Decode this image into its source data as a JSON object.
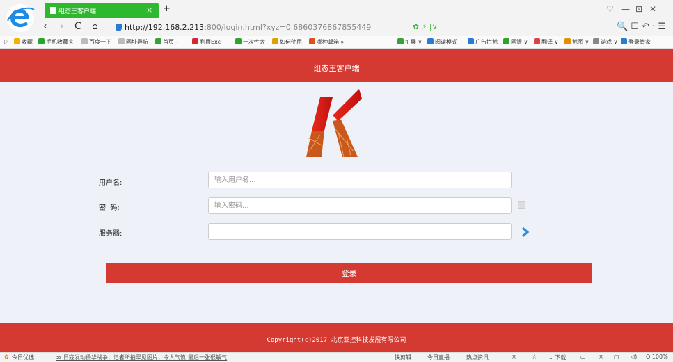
{
  "browser": {
    "tab_title": "组态王客户端",
    "tab_close": "×",
    "tab_new": "+",
    "url_host": "http://192.168.2.213",
    "url_rest": ":800/login.html?xyz=0.6860376867855449",
    "window_controls": [
      "♡",
      "—",
      "⊡",
      "✕"
    ],
    "nav": {
      "back": "‹",
      "forward": "›",
      "reload": "C",
      "home": "⌂"
    },
    "addr_right": "🔍  ☐  ↶ ·  ☰",
    "bookmarks_left": [
      {
        "label": "收藏",
        "color": "#f0b400"
      },
      {
        "label": "手机收藏夹",
        "color": "#2aa52a"
      },
      {
        "label": "百度一下",
        "color": "#bbbbbb"
      },
      {
        "label": "网址导航",
        "color": "#bbbbbb"
      },
      {
        "label": "首页 -",
        "color": "#3aa13a"
      },
      {
        "label": "利用Exc",
        "color": "#d9262c"
      },
      {
        "label": "一次性大",
        "color": "#2ca52c"
      },
      {
        "label": "如何使用",
        "color": "#e0a000"
      },
      {
        "label": "哪种邮箱 »",
        "color": "#e0501a"
      }
    ],
    "bookmarks_right": [
      {
        "label": "扩展 ∨",
        "color": "#3aa13a"
      },
      {
        "label": "阅读模式",
        "color": "#2b7ad6"
      },
      {
        "label": "广告拦截",
        "color": "#2b7ad6"
      },
      {
        "label": "网银 ∨",
        "color": "#2aa52a"
      },
      {
        "label": "翻译 ∨",
        "color": "#e04040"
      },
      {
        "label": "截图 ∨",
        "color": "#e09000"
      },
      {
        "label": "游戏 ∨",
        "color": "#888888"
      },
      {
        "label": "登录管家",
        "color": "#2b7ad6"
      }
    ]
  },
  "app": {
    "title": "组态王客户端",
    "form": {
      "username_label": "用户名:",
      "username_placeholder": "输入用户名...",
      "password_label": "密  码:",
      "password_placeholder": "输入密码...",
      "server_label": "服务器:",
      "server_value": ""
    },
    "login_button": "登录",
    "copyright": "Copyright(c)2017 北京亚控科技发展有限公司"
  },
  "statusbar": {
    "left": [
      "今日优选",
      "≫ 日寇发动侵华战争，记者所拍罕见图片，令人气愤!最后一张很解气"
    ],
    "right": [
      "快剪辑",
      "今日直播",
      "热点资讯",
      "◎",
      "☆",
      "↓ 下载",
      "▭",
      "◎",
      "▢",
      "◁)",
      "Q 100%"
    ]
  },
  "colors": {
    "brand_red": "#d53a32",
    "page_bg": "#eef1f7",
    "tab_green": "#2eb82e"
  }
}
